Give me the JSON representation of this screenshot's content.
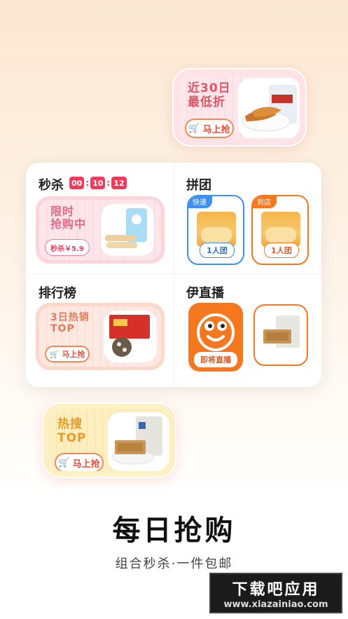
{
  "promo_top": {
    "text": "近30日\n最低折",
    "button": "马上抢"
  },
  "flash": {
    "title": "秒杀",
    "timer": [
      "00",
      "10",
      "12"
    ],
    "card_text": "限时\n抢购中",
    "price": "秒杀￥5.9"
  },
  "group": {
    "title": "拼团",
    "cards": [
      {
        "tag": "快递",
        "button": "1人团"
      },
      {
        "tag": "到店",
        "button": "1人团"
      }
    ]
  },
  "ranking": {
    "title": "排行榜",
    "card_text": "3日热销\nTOP",
    "button": "马上抢"
  },
  "live": {
    "title": "伊直播",
    "button": "即将直播"
  },
  "hot": {
    "text": "热搜\nTOP",
    "button": "马上抢"
  },
  "brand": {
    "name": "每日抢购",
    "slogan": "组合秒杀·一件包邮"
  },
  "watermark": {
    "top": "下载吧应用",
    "bottom": "www.xiazainiao.com"
  },
  "colors": {
    "accent": "#f2385b",
    "orange": "#f5781f",
    "blue": "#3d8ff0"
  }
}
